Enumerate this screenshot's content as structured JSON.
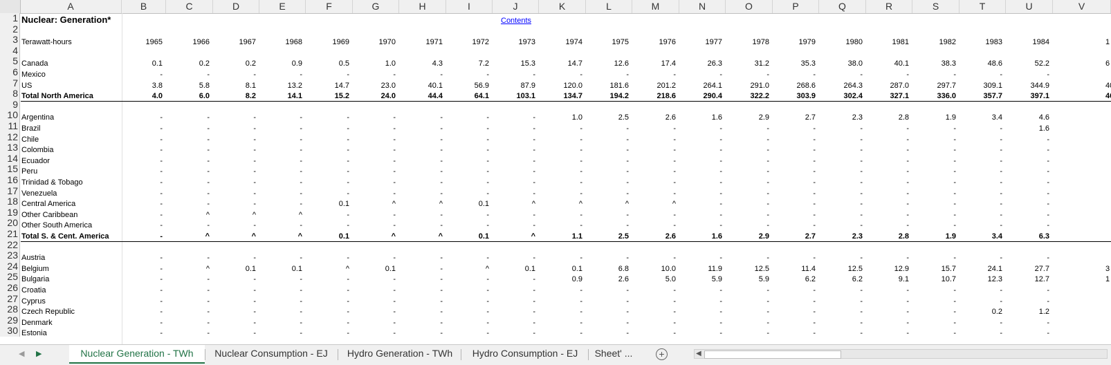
{
  "sheet": {
    "title": "Nuclear: Generation*",
    "contents_link": "Contents",
    "unit_label": "Terawatt-hours",
    "row_numbers": [
      "1",
      "2",
      "3",
      "4",
      "5",
      "6",
      "7",
      "8",
      "9",
      "10",
      "11",
      "12",
      "13",
      "14",
      "15",
      "16",
      "17",
      "18",
      "19",
      "20",
      "21",
      "22",
      "23",
      "24",
      "25",
      "26",
      "27",
      "28",
      "29",
      "30"
    ],
    "columns": [
      "A",
      "B",
      "C",
      "D",
      "E",
      "F",
      "G",
      "H",
      "I",
      "J",
      "K",
      "L",
      "M",
      "N",
      "O",
      "P",
      "Q",
      "R",
      "S",
      "T",
      "U",
      "V"
    ],
    "years": [
      "1965",
      "1966",
      "1967",
      "1968",
      "1969",
      "1970",
      "1971",
      "1972",
      "1973",
      "1974",
      "1975",
      "1976",
      "1977",
      "1978",
      "1979",
      "1980",
      "1981",
      "1982",
      "1983",
      "1984"
    ],
    "col21_partial": {
      "row3": "1",
      "row5": "6",
      "row7": "40",
      "row8": "46",
      "row24": "3",
      "row25": "1"
    },
    "data_rows": [
      {
        "row": 5,
        "label": "Canada",
        "bold": false,
        "values": [
          "0.1",
          "0.2",
          "0.2",
          "0.9",
          "0.5",
          "1.0",
          "4.3",
          "7.2",
          "15.3",
          "14.7",
          "12.6",
          "17.4",
          "26.3",
          "31.2",
          "35.3",
          "38.0",
          "40.1",
          "38.3",
          "48.6",
          "52.2"
        ]
      },
      {
        "row": 6,
        "label": "Mexico",
        "bold": false,
        "values": [
          "-",
          "-",
          "-",
          "-",
          "-",
          "-",
          "-",
          "-",
          "-",
          "-",
          "-",
          "-",
          "-",
          "-",
          "-",
          "-",
          "-",
          "-",
          "-",
          "-"
        ]
      },
      {
        "row": 7,
        "label": "US",
        "bold": false,
        "values": [
          "3.8",
          "5.8",
          "8.1",
          "13.2",
          "14.7",
          "23.0",
          "40.1",
          "56.9",
          "87.9",
          "120.0",
          "181.6",
          "201.2",
          "264.1",
          "291.0",
          "268.6",
          "264.3",
          "287.0",
          "297.7",
          "309.1",
          "344.9"
        ]
      },
      {
        "row": 8,
        "label": "Total North America",
        "bold": true,
        "values": [
          "4.0",
          "6.0",
          "8.2",
          "14.1",
          "15.2",
          "24.0",
          "44.4",
          "64.1",
          "103.1",
          "134.7",
          "194.2",
          "218.6",
          "290.4",
          "322.2",
          "303.9",
          "302.4",
          "327.1",
          "336.0",
          "357.7",
          "397.1"
        ]
      },
      {
        "row": 10,
        "label": "Argentina",
        "bold": false,
        "values": [
          "-",
          "-",
          "-",
          "-",
          "-",
          "-",
          "-",
          "-",
          "-",
          "1.0",
          "2.5",
          "2.6",
          "1.6",
          "2.9",
          "2.7",
          "2.3",
          "2.8",
          "1.9",
          "3.4",
          "4.6"
        ]
      },
      {
        "row": 11,
        "label": "Brazil",
        "bold": false,
        "values": [
          "-",
          "-",
          "-",
          "-",
          "-",
          "-",
          "-",
          "-",
          "-",
          "-",
          "-",
          "-",
          "-",
          "-",
          "-",
          "-",
          "-",
          "-",
          "-",
          "1.6"
        ]
      },
      {
        "row": 12,
        "label": "Chile",
        "bold": false,
        "values": [
          "-",
          "-",
          "-",
          "-",
          "-",
          "-",
          "-",
          "-",
          "-",
          "-",
          "-",
          "-",
          "-",
          "-",
          "-",
          "-",
          "-",
          "-",
          "-",
          "-"
        ]
      },
      {
        "row": 13,
        "label": "Colombia",
        "bold": false,
        "values": [
          "-",
          "-",
          "-",
          "-",
          "-",
          "-",
          "-",
          "-",
          "-",
          "-",
          "-",
          "-",
          "-",
          "-",
          "-",
          "-",
          "-",
          "-",
          "-",
          "-"
        ]
      },
      {
        "row": 14,
        "label": "Ecuador",
        "bold": false,
        "values": [
          "-",
          "-",
          "-",
          "-",
          "-",
          "-",
          "-",
          "-",
          "-",
          "-",
          "-",
          "-",
          "-",
          "-",
          "-",
          "-",
          "-",
          "-",
          "-",
          "-"
        ]
      },
      {
        "row": 15,
        "label": "Peru",
        "bold": false,
        "values": [
          "-",
          "-",
          "-",
          "-",
          "-",
          "-",
          "-",
          "-",
          "-",
          "-",
          "-",
          "-",
          "-",
          "-",
          "-",
          "-",
          "-",
          "-",
          "-",
          "-"
        ]
      },
      {
        "row": 16,
        "label": "Trinidad & Tobago",
        "bold": false,
        "values": [
          "-",
          "-",
          "-",
          "-",
          "-",
          "-",
          "-",
          "-",
          "-",
          "-",
          "-",
          "-",
          "-",
          "-",
          "-",
          "-",
          "-",
          "-",
          "-",
          "-"
        ]
      },
      {
        "row": 17,
        "label": "Venezuela",
        "bold": false,
        "values": [
          "-",
          "-",
          "-",
          "-",
          "-",
          "-",
          "-",
          "-",
          "-",
          "-",
          "-",
          "-",
          "-",
          "-",
          "-",
          "-",
          "-",
          "-",
          "-",
          "-"
        ]
      },
      {
        "row": 18,
        "label": "Central America",
        "bold": false,
        "values": [
          "-",
          "-",
          "-",
          "-",
          "0.1",
          "^",
          "^",
          "0.1",
          "^",
          "^",
          "^",
          "^",
          "-",
          "-",
          "-",
          "-",
          "-",
          "-",
          "-",
          "-"
        ]
      },
      {
        "row": 19,
        "label": "Other Caribbean",
        "bold": false,
        "values": [
          "-",
          "^",
          "^",
          "^",
          "-",
          "-",
          "-",
          "-",
          "-",
          "-",
          "-",
          "-",
          "-",
          "-",
          "-",
          "-",
          "-",
          "-",
          "-",
          "-"
        ]
      },
      {
        "row": 20,
        "label": "Other South America",
        "bold": false,
        "values": [
          "-",
          "-",
          "-",
          "-",
          "-",
          "-",
          "-",
          "-",
          "-",
          "-",
          "-",
          "-",
          "-",
          "-",
          "-",
          "-",
          "-",
          "-",
          "-",
          "-"
        ]
      },
      {
        "row": 21,
        "label": "Total S. & Cent. America",
        "bold": true,
        "values": [
          "-",
          "^",
          "^",
          "^",
          "0.1",
          "^",
          "^",
          "0.1",
          "^",
          "1.1",
          "2.5",
          "2.6",
          "1.6",
          "2.9",
          "2.7",
          "2.3",
          "2.8",
          "1.9",
          "3.4",
          "6.3"
        ]
      },
      {
        "row": 23,
        "label": "Austria",
        "bold": false,
        "values": [
          "-",
          "-",
          "-",
          "-",
          "-",
          "-",
          "-",
          "-",
          "-",
          "-",
          "-",
          "-",
          "-",
          "-",
          "-",
          "-",
          "-",
          "-",
          "-",
          "-"
        ]
      },
      {
        "row": 24,
        "label": "Belgium",
        "bold": false,
        "values": [
          "-",
          "^",
          "0.1",
          "0.1",
          "^",
          "0.1",
          "-",
          "^",
          "0.1",
          "0.1",
          "6.8",
          "10.0",
          "11.9",
          "12.5",
          "11.4",
          "12.5",
          "12.9",
          "15.7",
          "24.1",
          "27.7"
        ]
      },
      {
        "row": 25,
        "label": "Bulgaria",
        "bold": false,
        "values": [
          "-",
          "-",
          "-",
          "-",
          "-",
          "-",
          "-",
          "-",
          "-",
          "0.9",
          "2.6",
          "5.0",
          "5.9",
          "5.9",
          "6.2",
          "6.2",
          "9.1",
          "10.7",
          "12.3",
          "12.7"
        ]
      },
      {
        "row": 26,
        "label": "Croatia",
        "bold": false,
        "values": [
          "-",
          "-",
          "-",
          "-",
          "-",
          "-",
          "-",
          "-",
          "-",
          "-",
          "-",
          "-",
          "-",
          "-",
          "-",
          "-",
          "-",
          "-",
          "-",
          "-"
        ]
      },
      {
        "row": 27,
        "label": "Cyprus",
        "bold": false,
        "values": [
          "-",
          "-",
          "-",
          "-",
          "-",
          "-",
          "-",
          "-",
          "-",
          "-",
          "-",
          "-",
          "-",
          "-",
          "-",
          "-",
          "-",
          "-",
          "-",
          "-"
        ]
      },
      {
        "row": 28,
        "label": "Czech Republic",
        "bold": false,
        "values": [
          "-",
          "-",
          "-",
          "-",
          "-",
          "-",
          "-",
          "-",
          "-",
          "-",
          "-",
          "-",
          "-",
          "-",
          "-",
          "-",
          "-",
          "-",
          "0.2",
          "1.2"
        ]
      },
      {
        "row": 29,
        "label": "Denmark",
        "bold": false,
        "values": [
          "-",
          "-",
          "-",
          "-",
          "-",
          "-",
          "-",
          "-",
          "-",
          "-",
          "-",
          "-",
          "-",
          "-",
          "-",
          "-",
          "-",
          "-",
          "-",
          "-"
        ]
      },
      {
        "row": 30,
        "label": "Estonia",
        "bold": false,
        "values": [
          "-",
          "-",
          "-",
          "-",
          "-",
          "-",
          "-",
          "-",
          "-",
          "-",
          "-",
          "-",
          "-",
          "-",
          "-",
          "-",
          "-",
          "-",
          "-",
          "-"
        ]
      }
    ]
  },
  "tabs": [
    {
      "label": "Nuclear Generation - TWh",
      "active": true
    },
    {
      "label": "Nuclear Consumption - EJ",
      "active": false
    },
    {
      "label": "Hydro Generation - TWh",
      "active": false
    },
    {
      "label": "Hydro Consumption - EJ",
      "active": false
    },
    {
      "label": "Sheet' ...",
      "active": false
    }
  ],
  "nav": {
    "prev": "◀",
    "next": "▶",
    "add": "+"
  },
  "colors": {
    "accent": "#217346",
    "link": "#0000ff",
    "header_bg": "#f0f0f0"
  }
}
